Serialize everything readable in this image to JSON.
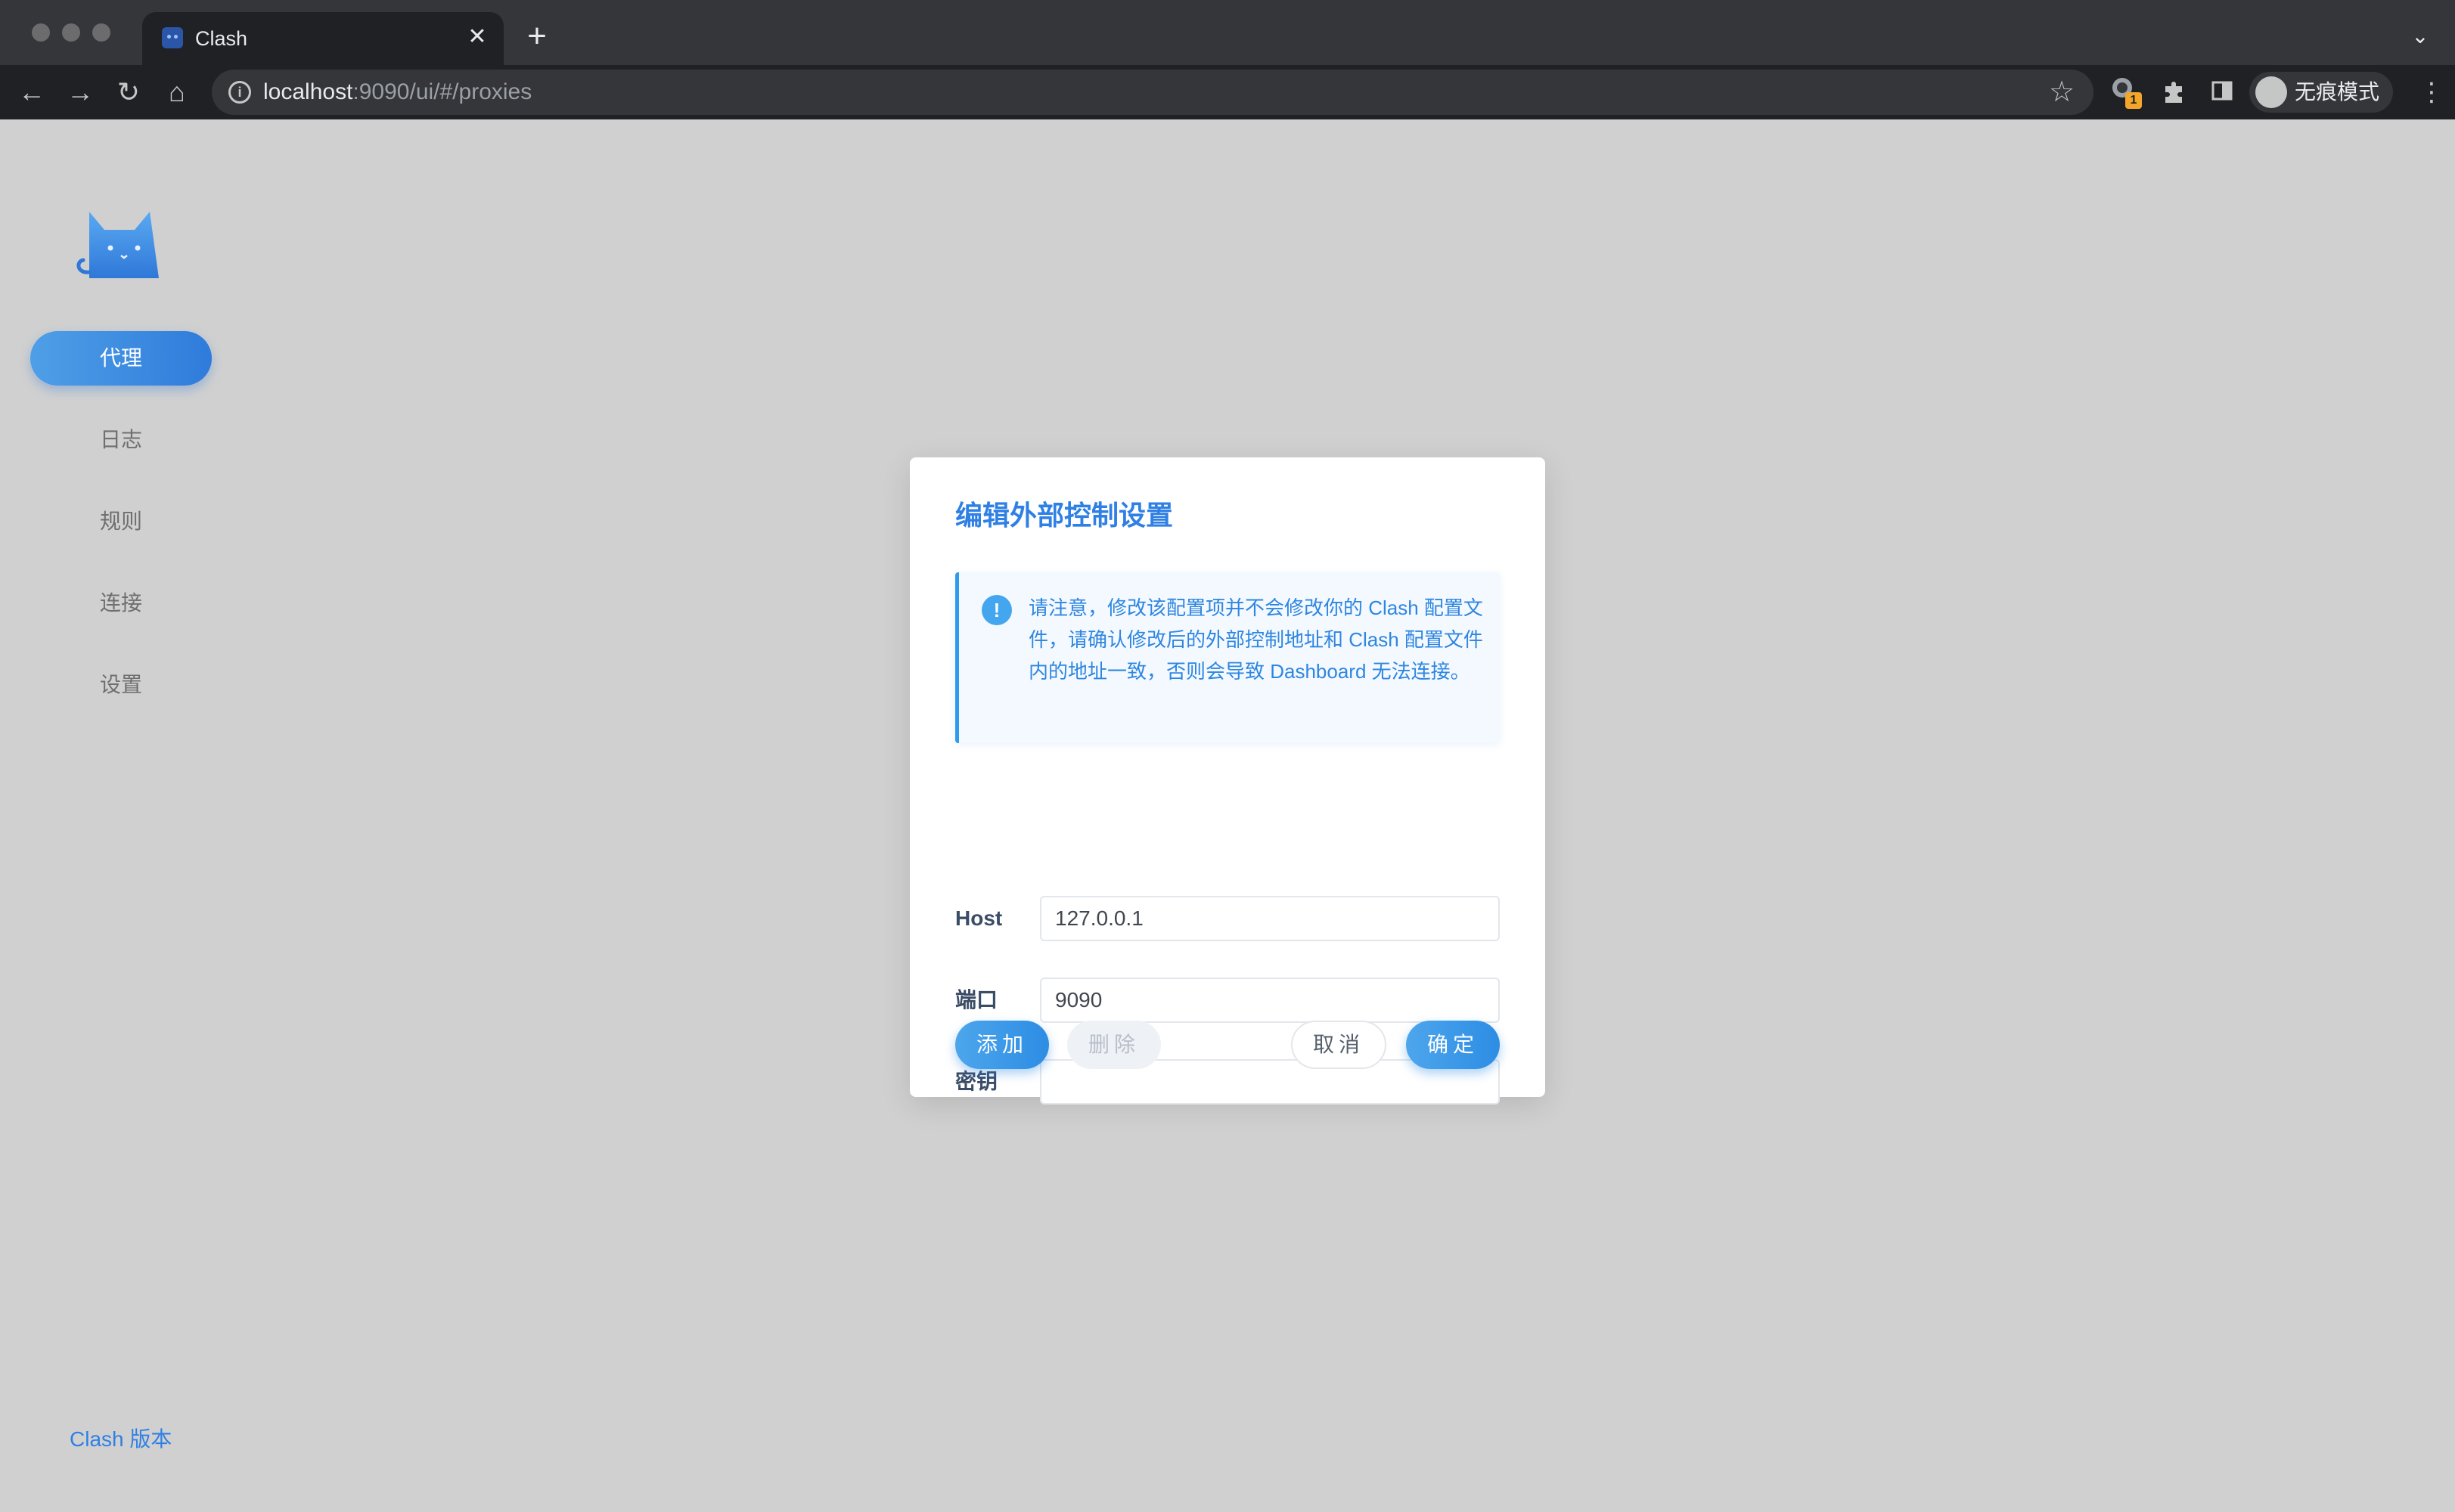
{
  "browser": {
    "tab_title": "Clash",
    "tab_close": "✕",
    "new_tab": "+",
    "url_host": "localhost",
    "url_rest": ":9090/ui/#/proxies",
    "extension_badge": "1",
    "incognito_label": "无痕模式"
  },
  "sidebar": {
    "items": [
      {
        "label": "代理",
        "active": true
      },
      {
        "label": "日志",
        "active": false
      },
      {
        "label": "规则",
        "active": false
      },
      {
        "label": "连接",
        "active": false
      },
      {
        "label": "设置",
        "active": false
      }
    ],
    "version_link": "Clash 版本"
  },
  "modal": {
    "title": "编辑外部控制设置",
    "alert_icon": "!",
    "alert_text": "请注意，修改该配置项并不会修改你的 Clash 配置文件，请确认修改后的外部控制地址和 Clash 配置文件内的地址一致，否则会导致 Dashboard 无法连接。",
    "fields": {
      "host": {
        "label": "Host",
        "value": "127.0.0.1"
      },
      "port": {
        "label": "端口",
        "value": "9090"
      },
      "secret": {
        "label": "密钥",
        "value": ""
      }
    },
    "buttons": {
      "add": "添加",
      "delete": "删除",
      "cancel": "取消",
      "ok": "确定"
    }
  },
  "colors": {
    "accent": "#2f80e4",
    "page_background": "#d0d0d0",
    "alert_background": "#f3f9ff"
  }
}
